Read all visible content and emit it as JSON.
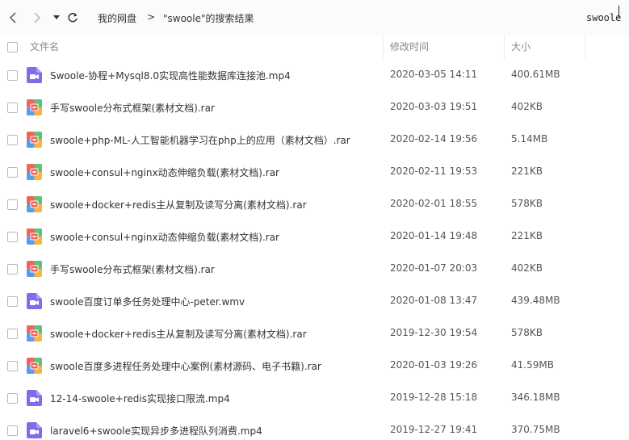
{
  "nav": {
    "back_icon": "chevron-left-icon",
    "forward_icon": "chevron-right-icon",
    "dropdown_icon": "caret-down-icon",
    "refresh_icon": "refresh-icon"
  },
  "breadcrumb": {
    "root": "我的网盘",
    "separator": ">",
    "current": "\"swoole\"的搜索结果"
  },
  "search": {
    "value": "swoole"
  },
  "table": {
    "columns": {
      "name": "文件名",
      "modified": "修改时间",
      "size": "大小"
    },
    "rows": [
      {
        "type": "video",
        "name": "Swoole-协程+Mysql8.0实现高性能数据库连接池.mp4",
        "modified": "2020-03-05 14:11",
        "size": "400.61MB"
      },
      {
        "type": "archive",
        "name": "手写swoole分布式框架(素材文档).rar",
        "modified": "2020-03-03 19:51",
        "size": "402KB"
      },
      {
        "type": "archive",
        "name": "swoole+php-ML-人工智能机器学习在php上的应用（素材文档）.rar",
        "modified": "2020-02-14 19:56",
        "size": "5.14MB"
      },
      {
        "type": "archive",
        "name": "swoole+consul+nginx动态伸缩负载(素材文档).rar",
        "modified": "2020-02-11 19:53",
        "size": "221KB"
      },
      {
        "type": "archive",
        "name": "swoole+docker+redis主从复制及读写分离(素材文档).rar",
        "modified": "2020-02-01 18:55",
        "size": "578KB"
      },
      {
        "type": "archive",
        "name": "swoole+consul+nginx动态伸缩负载(素材文档).rar",
        "modified": "2020-01-14 19:48",
        "size": "221KB"
      },
      {
        "type": "archive",
        "name": "手写swoole分布式框架(素材文档).rar",
        "modified": "2020-01-07 20:03",
        "size": "402KB"
      },
      {
        "type": "video",
        "name": "swoole百度订单多任务处理中心-peter.wmv",
        "modified": "2020-01-08 13:47",
        "size": "439.48MB"
      },
      {
        "type": "archive",
        "name": "swoole+docker+redis主从复制及读写分离(素材文档).rar",
        "modified": "2019-12-30 19:54",
        "size": "578KB"
      },
      {
        "type": "archive",
        "name": "swoole百度多进程任务处理中心案例(素材源码、电子书籍).rar",
        "modified": "2020-01-03 19:26",
        "size": "41.59MB"
      },
      {
        "type": "video",
        "name": "12-14-swoole+redis实现接口限流.mp4",
        "modified": "2019-12-28 15:18",
        "size": "346.18MB"
      },
      {
        "type": "video",
        "name": "laravel6+swoole实现异步多进程队列消费.mp4",
        "modified": "2019-12-27 19:41",
        "size": "370.75MB"
      }
    ]
  },
  "colors": {
    "video_icon": "#7b6ee8",
    "archive_red": "#f0635b",
    "archive_green": "#5ec27a",
    "archive_yellow": "#f5b53f",
    "archive_blue": "#5a9af0"
  }
}
